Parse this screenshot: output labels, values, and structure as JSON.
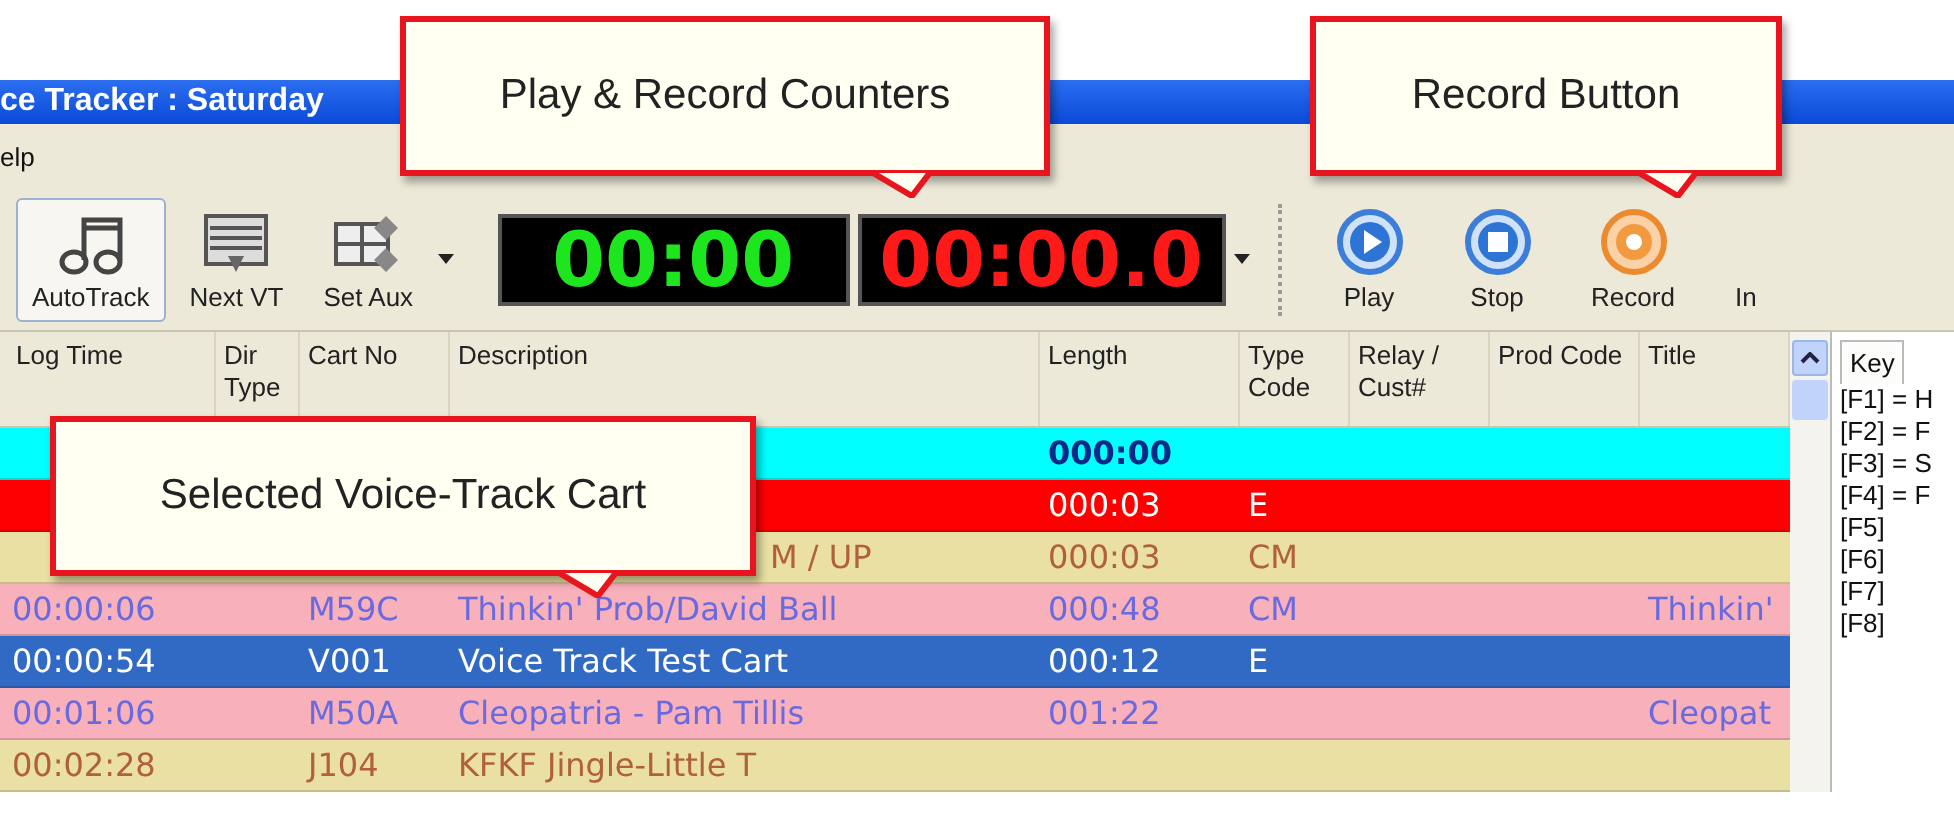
{
  "window": {
    "title": "ce Tracker : Saturday"
  },
  "menu": [
    {
      "label": "elp"
    }
  ],
  "toolbar": {
    "buttons": [
      {
        "label": "AutoTrack",
        "kind": "notes",
        "selected": true
      },
      {
        "label": "Next VT",
        "kind": "list",
        "selected": false
      },
      {
        "label": "Set Aux",
        "kind": "grid",
        "selected": false
      }
    ],
    "play_counter": "00:00",
    "record_counter": "00:00.0",
    "transport": [
      {
        "label": "Play",
        "kind": "play"
      },
      {
        "label": "Stop",
        "kind": "stop"
      },
      {
        "label": "Record",
        "kind": "record"
      },
      {
        "label": "In",
        "kind": "text"
      }
    ]
  },
  "table": {
    "columns": [
      "Log Time",
      "Dir Type",
      "Cart No",
      "Description",
      "Length",
      "Type Code",
      "Relay / Cust#",
      "Prod Code",
      "Title"
    ],
    "rows": [
      {
        "selected": false,
        "color": "#00ffff",
        "cells": [
          "",
          "",
          "",
          "",
          "000:00",
          "",
          "",
          "",
          ""
        ]
      },
      {
        "selected": false,
        "color": "#ff0000",
        "cells": [
          "",
          "",
          "",
          "",
          "000:03",
          "E",
          "",
          "",
          ""
        ]
      },
      {
        "selected": false,
        "color": "#ebe0a3",
        "cells": [
          "",
          "",
          "",
          "M / UP",
          "000:03",
          "CM",
          "",
          "",
          ""
        ]
      },
      {
        "selected": false,
        "color": "#f8b0bb",
        "cells": [
          "00:00:06",
          "",
          "M59C",
          "Thinkin' Prob/David Ball",
          "000:48",
          "CM",
          "",
          "",
          "Thinkin'"
        ]
      },
      {
        "selected": true,
        "cells": [
          "00:00:54",
          "",
          "V001",
          "Voice Track Test Cart",
          "000:12",
          "E",
          "",
          "",
          ""
        ]
      },
      {
        "selected": false,
        "color": "#f8b0bb",
        "cells": [
          "00:01:06",
          "",
          "M50A",
          "Cleopatria - Pam Tillis",
          "001:22",
          "",
          "",
          "",
          "Cleopat"
        ]
      },
      {
        "selected": false,
        "color": "#ebe0a3",
        "cells": [
          "00:02:28",
          "",
          "J104",
          "KFKF Jingle-Little T",
          "",
          "",
          "",
          "",
          ""
        ]
      }
    ]
  },
  "key_panel": {
    "tab": "Key",
    "lines": [
      "[F1] = H",
      "[F2] = F",
      "[F3] = S",
      "[F4] = F",
      "[F5]",
      "[F6]",
      "[F7]",
      "[F8]"
    ]
  },
  "callouts": [
    {
      "text": "Play & Record Counters"
    },
    {
      "text": "Record Button"
    },
    {
      "text": "Selected Voice-Track Cart"
    }
  ]
}
